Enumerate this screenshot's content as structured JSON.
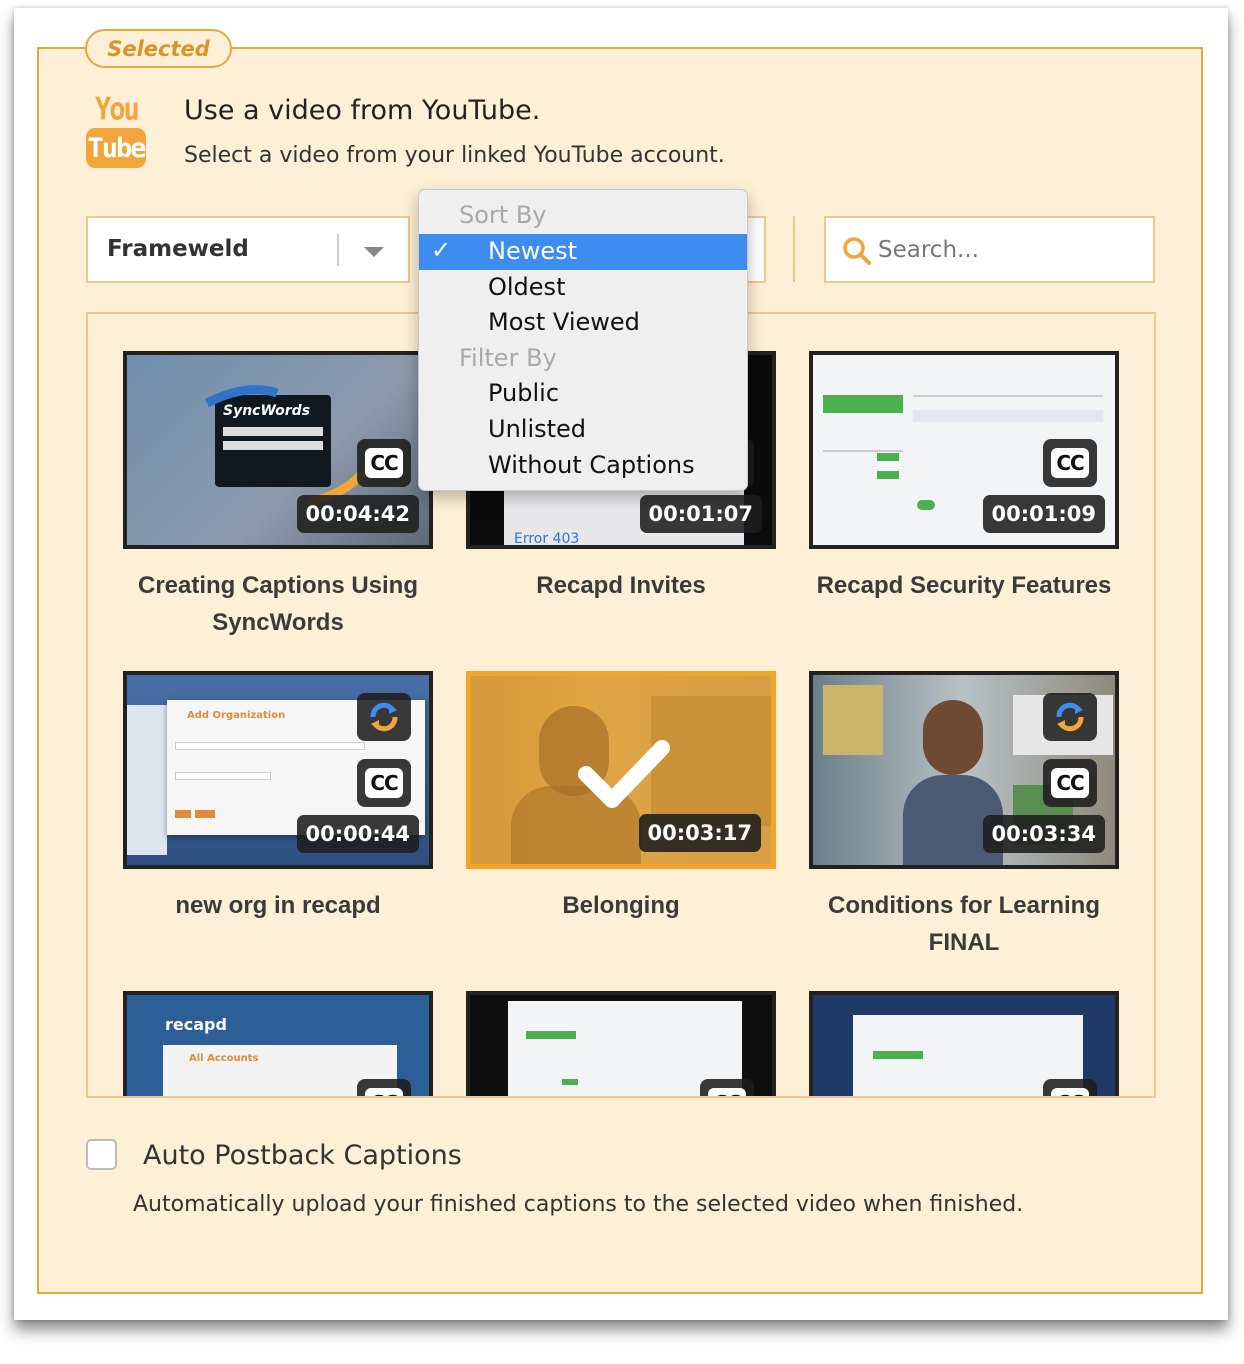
{
  "section_badge": "Selected",
  "header": {
    "logo_you": "You",
    "logo_tube": "Tube",
    "title": "Use a video from YouTube.",
    "subtitle": "Select a video from your linked YouTube account."
  },
  "account_select": {
    "value": "Frameweld"
  },
  "search": {
    "placeholder": "Search..."
  },
  "sort_menu": {
    "sort_header": "Sort By",
    "sort_options": [
      "Newest",
      "Oldest",
      "Most Viewed"
    ],
    "selected": "Newest",
    "filter_header": "Filter By",
    "filter_options": [
      "Public",
      "Unlisted",
      "Without Captions"
    ]
  },
  "videos": [
    {
      "title": "Creating Captions Using SyncWords",
      "duration": "00:04:42",
      "cc": true,
      "sync": false,
      "selected": false
    },
    {
      "title": "Recapd Invites",
      "duration": "00:01:07",
      "cc": true,
      "sync": false,
      "selected": false
    },
    {
      "title": "Recapd Security Features",
      "duration": "00:01:09",
      "cc": true,
      "sync": false,
      "selected": false
    },
    {
      "title": "new org in recapd",
      "duration": "00:00:44",
      "cc": true,
      "sync": true,
      "selected": false
    },
    {
      "title": "Belonging",
      "duration": "00:03:17",
      "cc": false,
      "sync": false,
      "selected": true
    },
    {
      "title": "Conditions for Learning FINAL",
      "duration": "00:03:34",
      "cc": true,
      "sync": true,
      "selected": false
    },
    {
      "title": "",
      "duration": "",
      "cc": true,
      "sync": false,
      "selected": false
    },
    {
      "title": "",
      "duration": "",
      "cc": true,
      "sync": false,
      "selected": false
    },
    {
      "title": "",
      "duration": "",
      "cc": true,
      "sync": false,
      "selected": false
    }
  ],
  "auto_postback": {
    "label": "Auto Postback Captions",
    "description": "Automatically upload your finished captions to the selected video when finished.",
    "checked": false
  },
  "thumbnail_texts": {
    "syncwords": "SyncWords",
    "error": "Error 403",
    "add_org": "Add Organization",
    "recapd": "recapd",
    "all_accounts": "All Accounts"
  },
  "badges": {
    "cc": "CC"
  },
  "colors": {
    "accent": "#e8a93b",
    "panel": "#fdf0d6",
    "menu_highlight": "#3d8cf0"
  }
}
